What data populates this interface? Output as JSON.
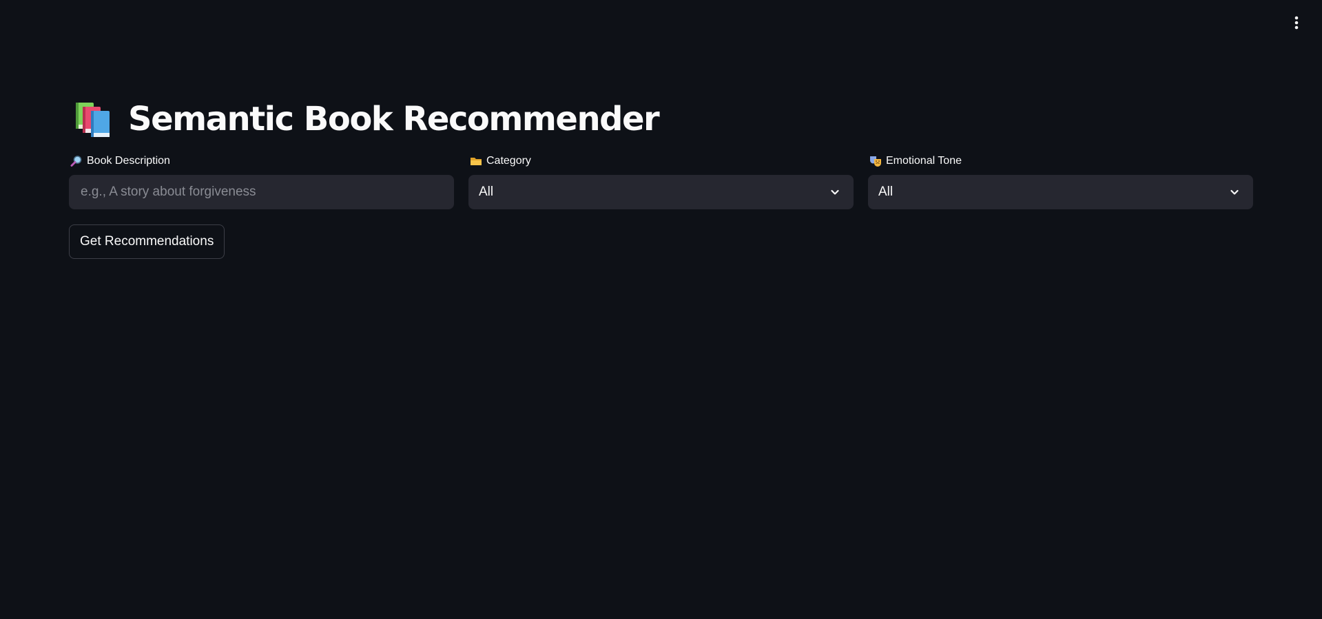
{
  "header": {
    "menu_icon": "vertical-ellipsis-icon"
  },
  "page": {
    "title": "Semantic Book Recommender",
    "title_icon": "books-emoji-icon"
  },
  "fields": {
    "description": {
      "label": "Book Description",
      "icon": "magnifying-glass-emoji-icon",
      "placeholder": "e.g., A story about forgiveness",
      "value": ""
    },
    "category": {
      "label": "Category",
      "icon": "folder-emoji-icon",
      "selected": "All"
    },
    "tone": {
      "label": "Emotional Tone",
      "icon": "performing-arts-emoji-icon",
      "selected": "All"
    }
  },
  "actions": {
    "submit_label": "Get Recommendations"
  },
  "colors": {
    "background": "#0e1117",
    "input_background": "#262730",
    "text": "#fafafa",
    "placeholder": "#8a8c94",
    "button_border": "#3d3f48"
  }
}
